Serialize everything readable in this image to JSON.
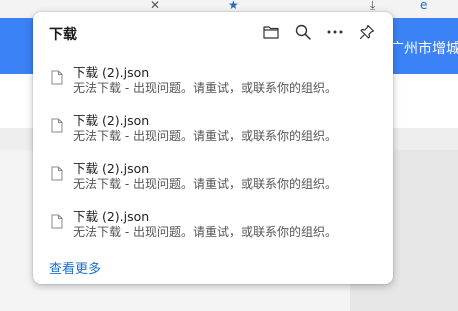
{
  "background": {
    "region_text": "广州市增城",
    "accent_color": "#3b82f6"
  },
  "panel": {
    "title": "下载",
    "header_icons": [
      "folder-icon",
      "search-icon",
      "more-icon",
      "pin-icon"
    ],
    "items": [
      {
        "name": "下载 (2).json",
        "status": "无法下载 - 出现问题。请重试，或联系你的组织。"
      },
      {
        "name": "下载 (2).json",
        "status": "无法下载 - 出现问题。请重试，或联系你的组织。"
      },
      {
        "name": "下载 (2).json",
        "status": "无法下载 - 出现问题。请重试，或联系你的组织。"
      },
      {
        "name": "下载 (2).json",
        "status": "无法下载 - 出现问题。请重试，或联系你的组织。"
      }
    ],
    "see_more": "查看更多",
    "link_color": "#1a6fc9"
  }
}
